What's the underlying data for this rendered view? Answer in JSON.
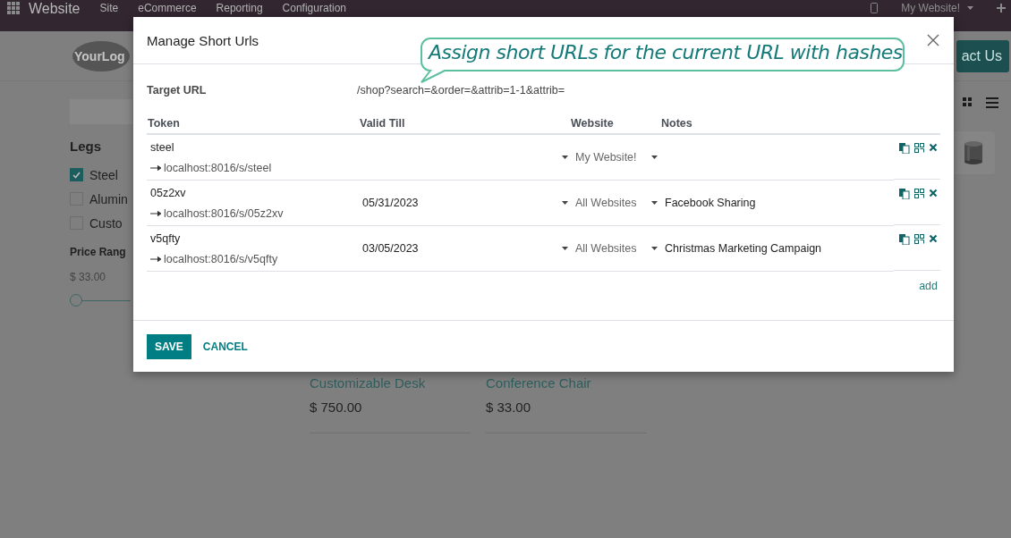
{
  "topbar": {
    "app": "Website",
    "menu": [
      "Site",
      "eCommerce",
      "Reporting",
      "Configuration"
    ],
    "website_switcher": "My Website!"
  },
  "page": {
    "logo": "YourLog",
    "contact_button": "act Us",
    "filter": {
      "title": "Legs",
      "options": [
        {
          "label": "Steel",
          "checked": true
        },
        {
          "label": "Alumin",
          "checked": false
        },
        {
          "label": "Custo",
          "checked": false
        }
      ]
    },
    "price": {
      "title": "Price Rang",
      "min": "$ 33.00",
      "level": 0
    },
    "products": [
      {
        "name": "Customizable Desk",
        "price": "$ 750.00"
      },
      {
        "name": "Conference Chair",
        "price": "$ 33.00"
      }
    ]
  },
  "dialog": {
    "title": "Manage Short Urls",
    "target_label": "Target URL",
    "target_url": "/shop?search=&order=&attrib=1-1&attrib=",
    "columns": [
      "Token",
      "Valid Till",
      "Website",
      "Notes"
    ],
    "rows": [
      {
        "token": "steel",
        "short_url": "localhost:8016/s/steel",
        "website": "My Website!"
      },
      {
        "token": "05z2xv",
        "short_url": "localhost:8016/s/05z2xv",
        "valid_till": "05/31/2023",
        "website": "All Websites",
        "notes": "Facebook Sharing"
      },
      {
        "token": "v5qfty",
        "short_url": "localhost:8016/s/v5qfty",
        "valid_till": "03/05/2023",
        "website": "All Websites",
        "notes": "Christmas Marketing Campaign"
      }
    ],
    "add": "add",
    "save": "SAVE",
    "cancel": "CANCEL"
  },
  "callout": "Assign short URLs for the current URL with hashes"
}
